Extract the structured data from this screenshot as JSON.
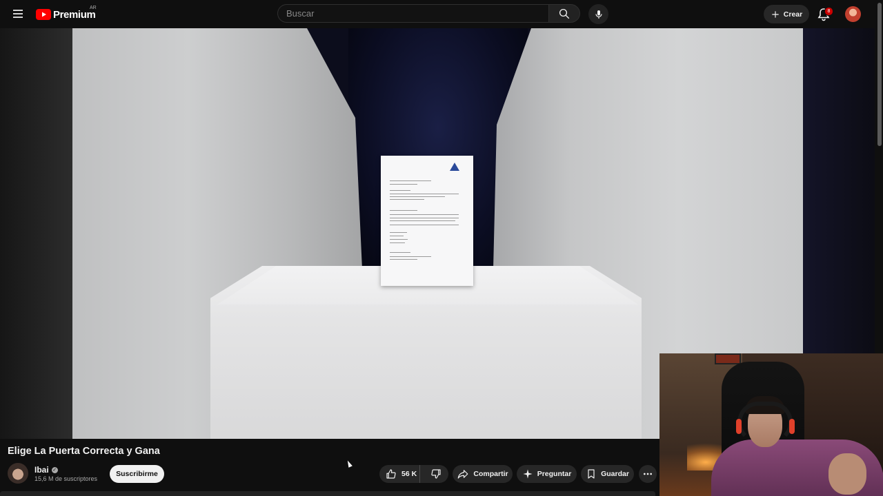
{
  "header": {
    "logo_text": "Premium",
    "country_code": "AR",
    "search_placeholder": "Buscar",
    "create_label": "Crear",
    "notification_count": "8"
  },
  "icons": {
    "menu": "menu-icon",
    "search": "search-icon",
    "mic": "mic-icon",
    "create": "plus-icon",
    "bell": "bell-icon",
    "like": "thumbs-up-icon",
    "dislike": "thumbs-down-icon",
    "share": "share-icon",
    "ask": "sparkle-icon",
    "save": "bookmark-icon",
    "more": "more-horizontal-icon"
  },
  "video": {
    "title": "Elige La Puerta Correcta y Gana"
  },
  "channel": {
    "name": "Ibai",
    "subscribers": "15,6 M de suscriptores",
    "subscribe_label": "Suscribirme"
  },
  "actions": {
    "like_count": "56 K",
    "share_label": "Compartir",
    "ask_label": "Preguntar",
    "save_label": "Guardar"
  },
  "colors": {
    "background": "#0f0f0f",
    "brand_red": "#ff0000",
    "pill_bg": "#272727",
    "badge_red": "#cc0000"
  }
}
